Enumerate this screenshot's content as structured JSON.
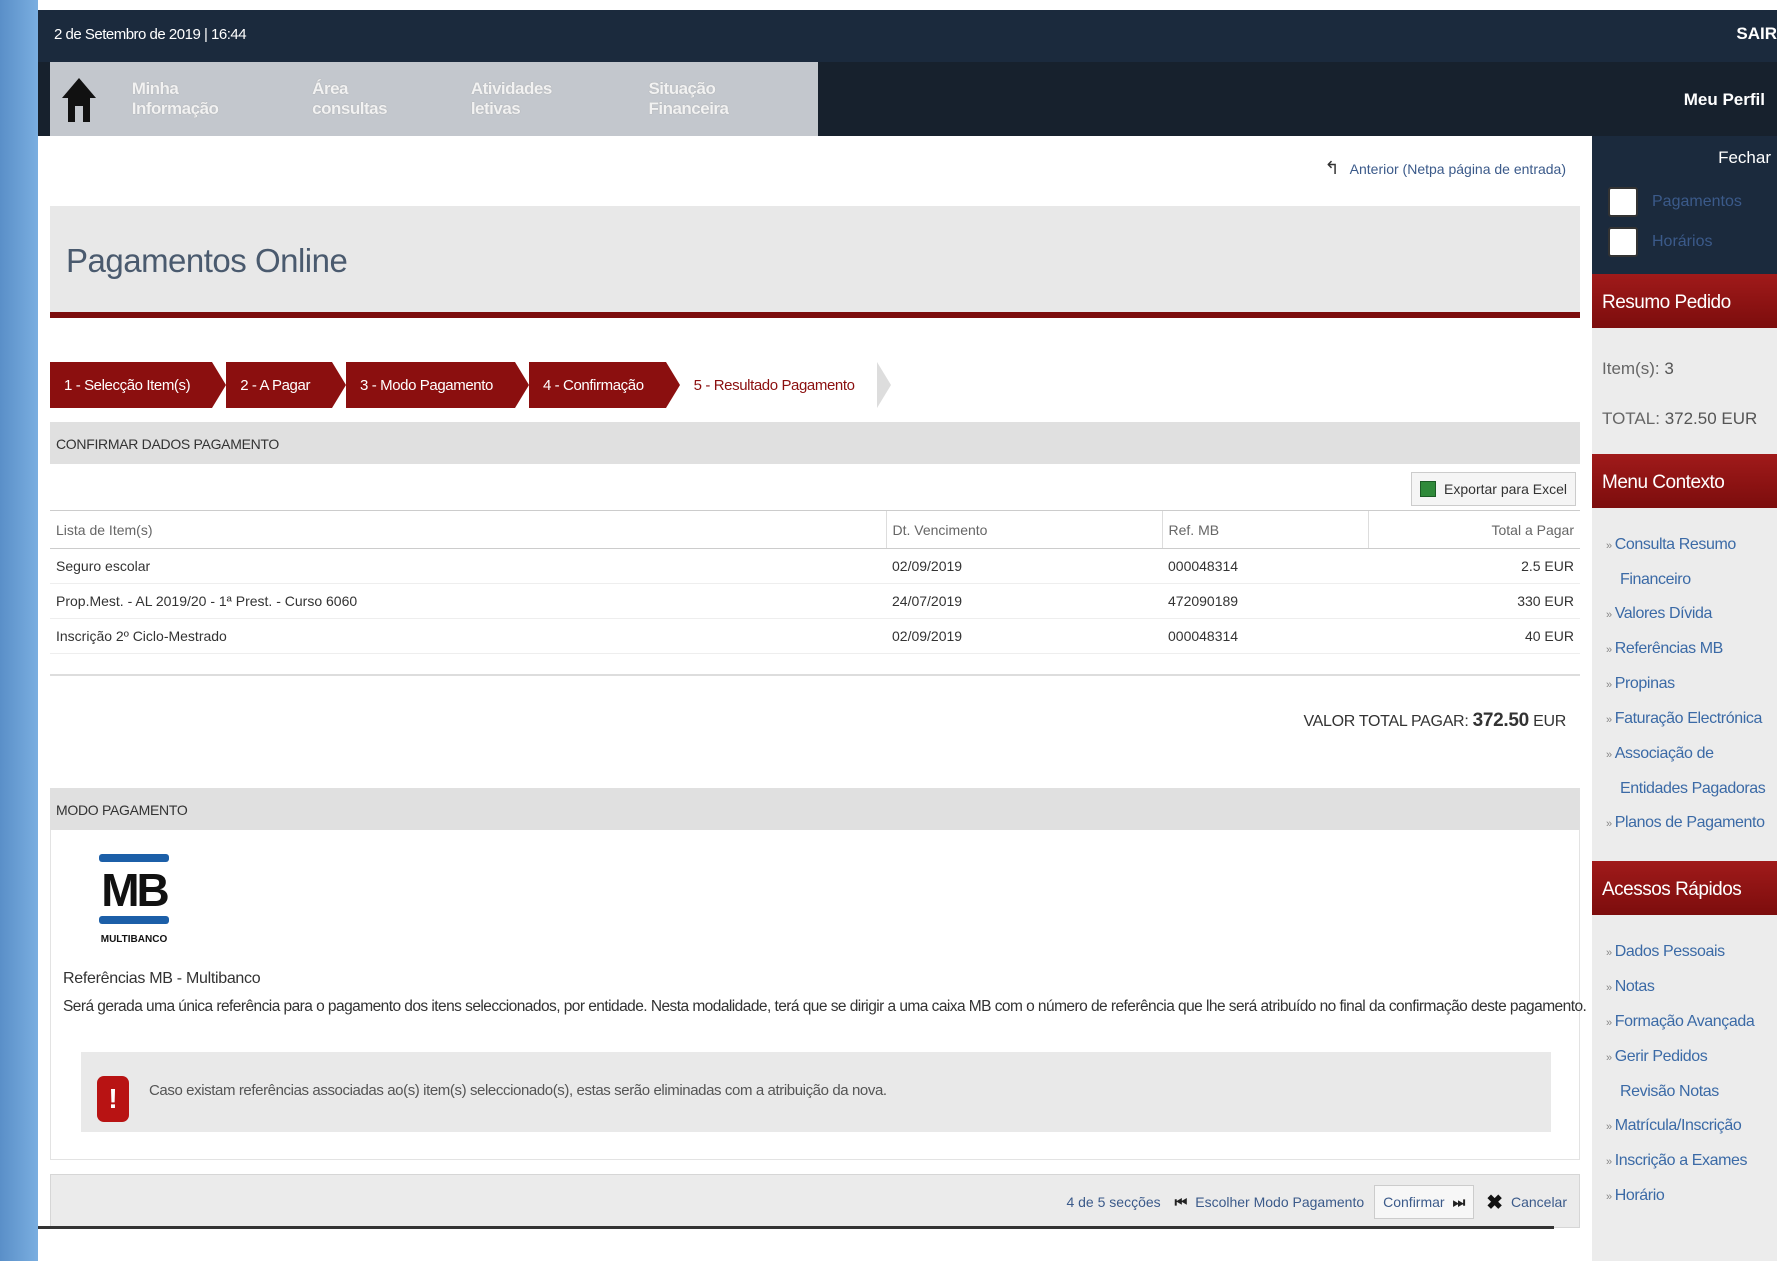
{
  "topbar": {
    "date": "2 de Setembro de 2019 | 16:44",
    "logout": "SAIR"
  },
  "nav": {
    "items": [
      "Minha Informação",
      "Área consultas",
      "Atividades letivas",
      "Situação Financeira"
    ],
    "profile": "Meu Perfil"
  },
  "sidebar": {
    "close": "Fechar",
    "shortcuts": [
      "Pagamentos",
      "Horários"
    ],
    "summary_title": "Resumo Pedido",
    "items_label": "Item(s):",
    "items_count": "3",
    "total_label": "TOTAL:",
    "total_value": "372.50 EUR",
    "context_title": "Menu Contexto",
    "context_links": [
      [
        "Consulta Resumo",
        "Financeiro"
      ],
      [
        "Valores Dívida"
      ],
      [
        "Referências MB"
      ],
      [
        "Propinas"
      ],
      [
        "Faturação Electrónica"
      ],
      [
        "Associação de",
        "Entidades Pagadoras"
      ],
      [
        "Planos de Pagamento"
      ]
    ],
    "quick_title": "Acessos Rápidos",
    "quick_links": [
      [
        "Dados Pessoais"
      ],
      [
        "Notas"
      ],
      [
        "Formação Avançada"
      ],
      [
        "Gerir Pedidos",
        "Revisão Notas"
      ],
      [
        "Matrícula/Inscrição"
      ],
      [
        "Inscrição a Exames"
      ],
      [
        "Horário"
      ]
    ]
  },
  "main": {
    "back_link": "Anterior (Netpa página de entrada)",
    "title": "Pagamentos Online",
    "steps": [
      {
        "label": "1 - Selecção Item(s)",
        "active": true
      },
      {
        "label": "2 - A Pagar",
        "active": true
      },
      {
        "label": "3 - Modo Pagamento",
        "active": true
      },
      {
        "label": "4 - Confirmação",
        "active": true
      },
      {
        "label": "5 - Resultado Pagamento",
        "active": false
      }
    ],
    "confirm_header": "CONFIRMAR DADOS PAGAMENTO",
    "export_label": "Exportar para Excel",
    "table": {
      "headers": [
        "Lista de Item(s)",
        "Dt. Vencimento",
        "Ref. MB",
        "Total a Pagar"
      ],
      "rows": [
        [
          "Seguro escolar",
          "02/09/2019",
          "000048314",
          "2.5 EUR"
        ],
        [
          "Prop.Mest. - AL 2019/20 - 1ª Prest. - Curso 6060",
          "24/07/2019",
          "472090189",
          "330 EUR"
        ],
        [
          "Inscrição 2º Ciclo-Mestrado",
          "02/09/2019",
          "000048314",
          "40 EUR"
        ]
      ]
    },
    "total_label": "VALOR TOTAL PAGAR:",
    "total_amount": "372.50",
    "total_currency": "EUR",
    "payment_header": "MODO PAGAMENTO",
    "mb_logo_text": "MB",
    "mb_logo_sub": "MULTIBANCO",
    "mb_name": "Referências MB - Multibanco",
    "mb_description": "Será gerada uma única referência para o pagamento dos itens seleccionados, por entidade. Nesta modalidade, terá que se dirigir a uma caixa MB com o número de referência que lhe será atribuído no final da confirmação deste pagamento.",
    "alert_text": "Caso existam referências associadas ao(s) item(s) seleccionado(s), estas serão eliminadas com a atribuição da nova."
  },
  "footer": {
    "sections": "4 de 5 secções",
    "prev_label": "Escolher Modo Pagamento",
    "confirm_label": "Confirmar",
    "cancel_label": "Cancelar"
  },
  "colors": {
    "brand": "#8b0f0f",
    "dark": "#1b2a3d",
    "link": "#3b5a8a"
  }
}
